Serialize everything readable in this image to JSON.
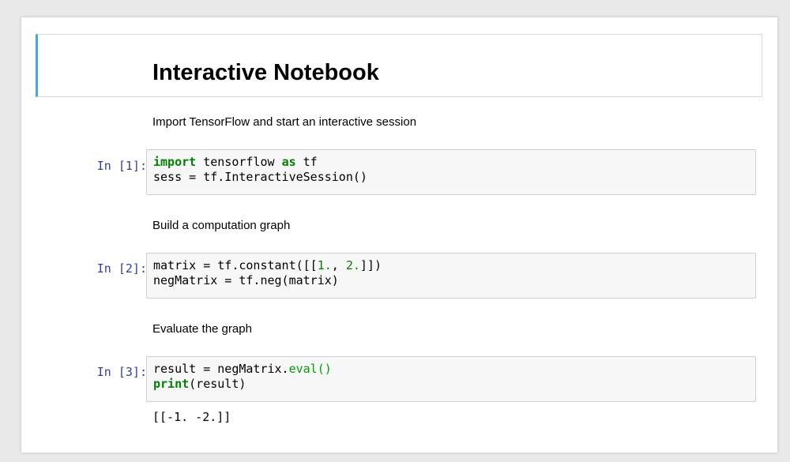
{
  "notebook": {
    "title": "Interactive Notebook"
  },
  "cells": [
    {
      "markdown": "Import TensorFlow and start an interactive session",
      "prompt": "In [1]:",
      "code": [
        [
          {
            "t": "import",
            "c": "kw"
          },
          {
            "t": " tensorflow "
          },
          {
            "t": "as",
            "c": "kw"
          },
          {
            "t": " tf"
          }
        ],
        [
          {
            "t": "sess = tf.InteractiveSession()"
          }
        ]
      ]
    },
    {
      "markdown": "Build a computation graph",
      "prompt": "In [2]:",
      "code": [
        [
          {
            "t": "matrix = tf.constant([["
          },
          {
            "t": "1.",
            "c": "num"
          },
          {
            "t": ", "
          },
          {
            "t": "2.",
            "c": "num"
          },
          {
            "t": "]])"
          }
        ],
        [
          {
            "t": "negMatrix = tf.neg(matrix)"
          }
        ]
      ]
    },
    {
      "markdown": "Evaluate the graph",
      "prompt": "In [3]:",
      "code": [
        [
          {
            "t": "result = negMatrix."
          },
          {
            "t": "eval()",
            "c": "fn"
          }
        ],
        [
          {
            "t": "print",
            "c": "kw"
          },
          {
            "t": "(result)"
          }
        ]
      ],
      "output": "[[-1. -2.]]"
    }
  ],
  "colors": {
    "title_border_accent": "#42a5f5",
    "prompt": "#303f9f",
    "keyword": "#008000"
  }
}
